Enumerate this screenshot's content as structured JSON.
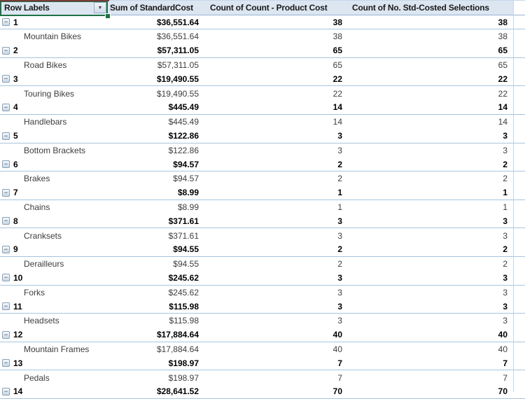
{
  "table": {
    "columns": [
      {
        "label": "Row Labels"
      },
      {
        "label": "Sum of StandardCost"
      },
      {
        "label": "Count of Count - Product Cost"
      },
      {
        "label": "Count of No. Std-Costed Selections"
      }
    ],
    "icons": {
      "collapse": "−",
      "dropdown": "▼"
    },
    "colors": {
      "header_bg": "#dce6f1",
      "header_border": "#95b3d7",
      "row_border": "#a9c4de",
      "selection_green": "#1e7145",
      "top_stripe": "#7a3a3a",
      "group_text": "#000000",
      "detail_text": "#3d3d3d"
    },
    "rows": [
      {
        "type": "group",
        "label": "1",
        "cost": "$36,551.64",
        "count_product_cost": "38",
        "count_selections": "38"
      },
      {
        "type": "detail",
        "label": "Mountain Bikes",
        "cost": "$36,551.64",
        "count_product_cost": "38",
        "count_selections": "38"
      },
      {
        "type": "group",
        "label": "2",
        "cost": "$57,311.05",
        "count_product_cost": "65",
        "count_selections": "65"
      },
      {
        "type": "detail",
        "label": "Road Bikes",
        "cost": "$57,311.05",
        "count_product_cost": "65",
        "count_selections": "65"
      },
      {
        "type": "group",
        "label": "3",
        "cost": "$19,490.55",
        "count_product_cost": "22",
        "count_selections": "22"
      },
      {
        "type": "detail",
        "label": "Touring Bikes",
        "cost": "$19,490.55",
        "count_product_cost": "22",
        "count_selections": "22"
      },
      {
        "type": "group",
        "label": "4",
        "cost": "$445.49",
        "count_product_cost": "14",
        "count_selections": "14"
      },
      {
        "type": "detail",
        "label": "Handlebars",
        "cost": "$445.49",
        "count_product_cost": "14",
        "count_selections": "14"
      },
      {
        "type": "group",
        "label": "5",
        "cost": "$122.86",
        "count_product_cost": "3",
        "count_selections": "3"
      },
      {
        "type": "detail",
        "label": "Bottom Brackets",
        "cost": "$122.86",
        "count_product_cost": "3",
        "count_selections": "3"
      },
      {
        "type": "group",
        "label": "6",
        "cost": "$94.57",
        "count_product_cost": "2",
        "count_selections": "2"
      },
      {
        "type": "detail",
        "label": "Brakes",
        "cost": "$94.57",
        "count_product_cost": "2",
        "count_selections": "2"
      },
      {
        "type": "group",
        "label": "7",
        "cost": "$8.99",
        "count_product_cost": "1",
        "count_selections": "1"
      },
      {
        "type": "detail",
        "label": "Chains",
        "cost": "$8.99",
        "count_product_cost": "1",
        "count_selections": "1"
      },
      {
        "type": "group",
        "label": "8",
        "cost": "$371.61",
        "count_product_cost": "3",
        "count_selections": "3"
      },
      {
        "type": "detail",
        "label": "Cranksets",
        "cost": "$371.61",
        "count_product_cost": "3",
        "count_selections": "3"
      },
      {
        "type": "group",
        "label": "9",
        "cost": "$94.55",
        "count_product_cost": "2",
        "count_selections": "2"
      },
      {
        "type": "detail",
        "label": "Derailleurs",
        "cost": "$94.55",
        "count_product_cost": "2",
        "count_selections": "2"
      },
      {
        "type": "group",
        "label": "10",
        "cost": "$245.62",
        "count_product_cost": "3",
        "count_selections": "3"
      },
      {
        "type": "detail",
        "label": "Forks",
        "cost": "$245.62",
        "count_product_cost": "3",
        "count_selections": "3"
      },
      {
        "type": "group",
        "label": "11",
        "cost": "$115.98",
        "count_product_cost": "3",
        "count_selections": "3"
      },
      {
        "type": "detail",
        "label": "Headsets",
        "cost": "$115.98",
        "count_product_cost": "3",
        "count_selections": "3"
      },
      {
        "type": "group",
        "label": "12",
        "cost": "$17,884.64",
        "count_product_cost": "40",
        "count_selections": "40"
      },
      {
        "type": "detail",
        "label": "Mountain Frames",
        "cost": "$17,884.64",
        "count_product_cost": "40",
        "count_selections": "40"
      },
      {
        "type": "group",
        "label": "13",
        "cost": "$198.97",
        "count_product_cost": "7",
        "count_selections": "7"
      },
      {
        "type": "detail",
        "label": "Pedals",
        "cost": "$198.97",
        "count_product_cost": "7",
        "count_selections": "7"
      },
      {
        "type": "group",
        "label": "14",
        "cost": "$28,641.52",
        "count_product_cost": "70",
        "count_selections": "70"
      }
    ]
  }
}
